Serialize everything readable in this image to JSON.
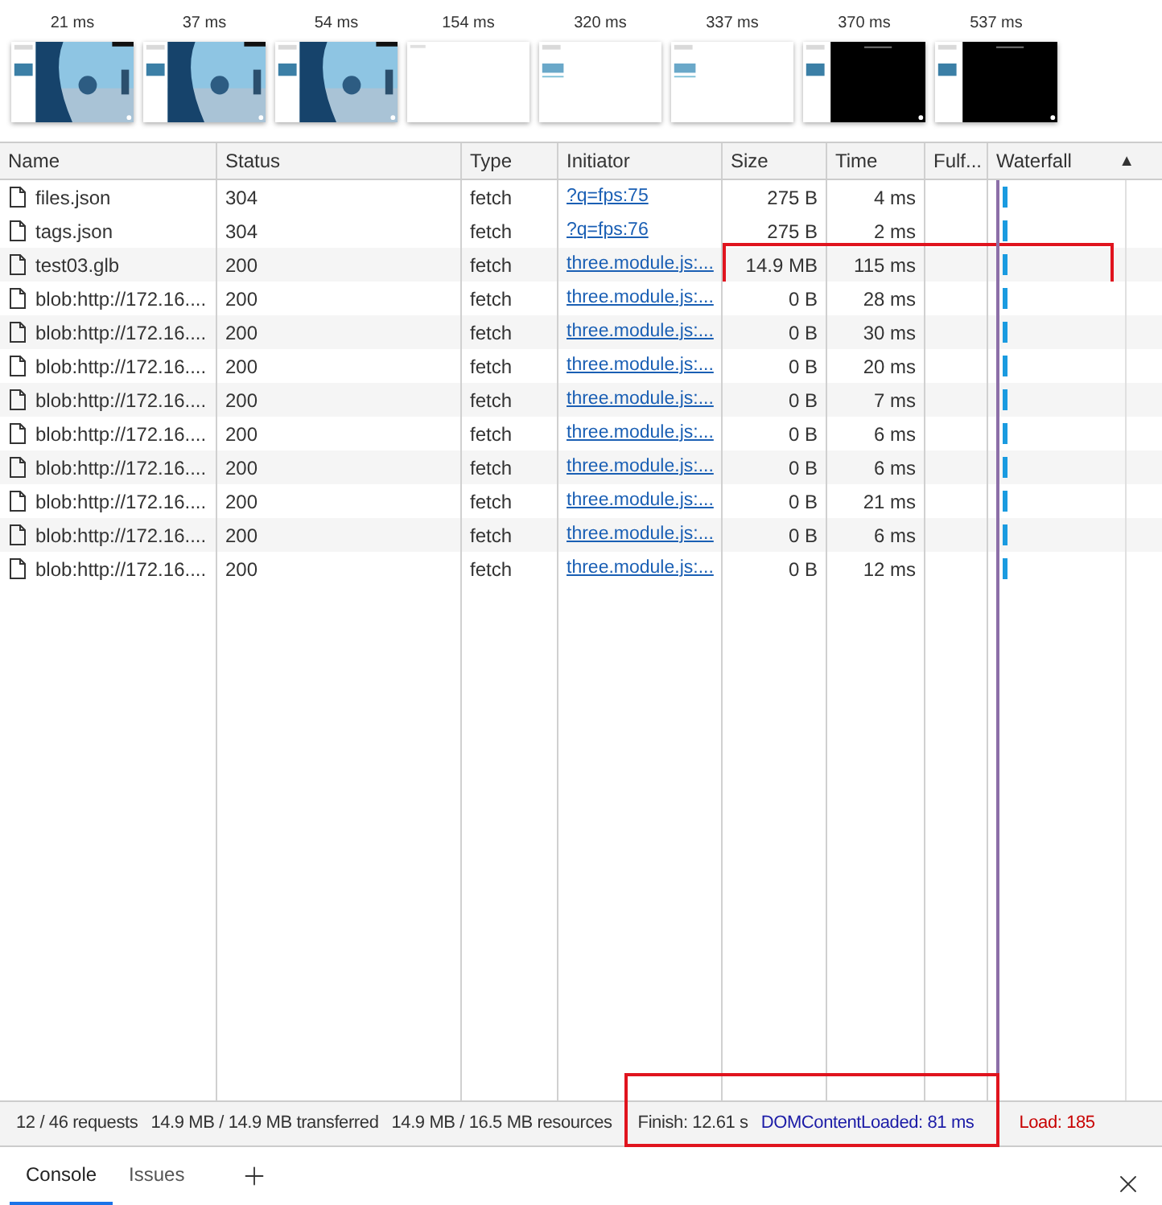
{
  "filmstrip": [
    {
      "time": "21 ms",
      "kind": "scene"
    },
    {
      "time": "37 ms",
      "kind": "scene"
    },
    {
      "time": "54 ms",
      "kind": "scene"
    },
    {
      "time": "154 ms",
      "kind": "blank"
    },
    {
      "time": "320 ms",
      "kind": "sparse"
    },
    {
      "time": "337 ms",
      "kind": "sparse"
    },
    {
      "time": "370 ms",
      "kind": "dark"
    },
    {
      "time": "537 ms",
      "kind": "dark"
    }
  ],
  "table": {
    "columns": [
      "Name",
      "Status",
      "Type",
      "Initiator",
      "Size",
      "Time",
      "Fulf...",
      "Waterfall"
    ],
    "sort_indicator": "▲",
    "rows": [
      {
        "name": "files.json",
        "status": "304",
        "type": "fetch",
        "initiator": "?q=fps:75",
        "size": "275 B",
        "time": "4 ms",
        "highlighted": false
      },
      {
        "name": "tags.json",
        "status": "304",
        "type": "fetch",
        "initiator": "?q=fps:76",
        "size": "275 B",
        "time": "2 ms",
        "highlighted": false
      },
      {
        "name": "test03.glb",
        "status": "200",
        "type": "fetch",
        "initiator": "three.module.js:...",
        "size": "14.9 MB",
        "time": "115 ms",
        "highlighted": true
      },
      {
        "name": "blob:http://172.16....",
        "status": "200",
        "type": "fetch",
        "initiator": "three.module.js:...",
        "size": "0 B",
        "time": "28 ms",
        "highlighted": false
      },
      {
        "name": "blob:http://172.16....",
        "status": "200",
        "type": "fetch",
        "initiator": "three.module.js:...",
        "size": "0 B",
        "time": "30 ms",
        "highlighted": false
      },
      {
        "name": "blob:http://172.16....",
        "status": "200",
        "type": "fetch",
        "initiator": "three.module.js:...",
        "size": "0 B",
        "time": "20 ms",
        "highlighted": false
      },
      {
        "name": "blob:http://172.16....",
        "status": "200",
        "type": "fetch",
        "initiator": "three.module.js:...",
        "size": "0 B",
        "time": "7 ms",
        "highlighted": false
      },
      {
        "name": "blob:http://172.16....",
        "status": "200",
        "type": "fetch",
        "initiator": "three.module.js:...",
        "size": "0 B",
        "time": "6 ms",
        "highlighted": false
      },
      {
        "name": "blob:http://172.16....",
        "status": "200",
        "type": "fetch",
        "initiator": "three.module.js:...",
        "size": "0 B",
        "time": "6 ms",
        "highlighted": false
      },
      {
        "name": "blob:http://172.16....",
        "status": "200",
        "type": "fetch",
        "initiator": "three.module.js:...",
        "size": "0 B",
        "time": "21 ms",
        "highlighted": false
      },
      {
        "name": "blob:http://172.16....",
        "status": "200",
        "type": "fetch",
        "initiator": "three.module.js:...",
        "size": "0 B",
        "time": "6 ms",
        "highlighted": false
      },
      {
        "name": "blob:http://172.16....",
        "status": "200",
        "type": "fetch",
        "initiator": "three.module.js:...",
        "size": "0 B",
        "time": "12 ms",
        "highlighted": false
      }
    ]
  },
  "status_bar": {
    "items": [
      {
        "text": "12 / 46 requests",
        "kind": "plain",
        "highlighted": false
      },
      {
        "text": "14.9 MB / 14.9 MB transferred",
        "kind": "plain",
        "highlighted": false
      },
      {
        "text": "14.9 MB / 16.5 MB resources",
        "kind": "plain",
        "highlighted": false
      },
      {
        "text": "Finish: 12.61 s",
        "kind": "plain",
        "highlighted": true
      },
      {
        "text": "DOMContentLoaded: 81 ms",
        "kind": "dom",
        "highlighted": true
      },
      {
        "text": "Load: 185",
        "kind": "load",
        "highlighted": false
      }
    ]
  },
  "drawer_tabs": [
    {
      "label": "Console",
      "selected": true
    },
    {
      "label": "Issues",
      "selected": false
    }
  ]
}
